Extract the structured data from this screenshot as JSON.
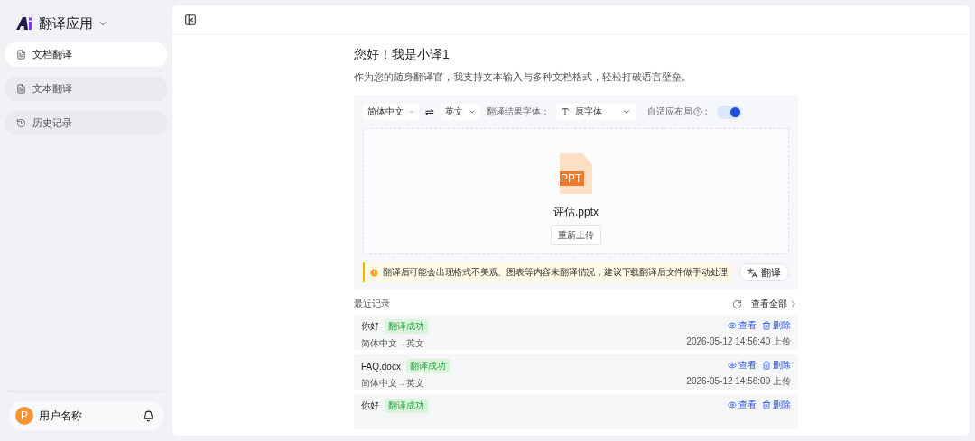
{
  "app": {
    "title": "翻译应用"
  },
  "sidebar": {
    "items": [
      {
        "label": "文档翻译",
        "selected": true
      },
      {
        "label": "文本翻译",
        "selected": false
      },
      {
        "label": "历史记录",
        "selected": false
      }
    ],
    "user": {
      "avatar": "P",
      "name": "用户名称"
    }
  },
  "greeting": {
    "title": "您好！我是小译1",
    "subtitle": "作为您的随身翻译官，我支持文本输入与多种文档格式，轻松打破语言壁垒。"
  },
  "toolbar": {
    "source_language": "简体中文",
    "swap": "⇌",
    "target_language": "英文",
    "font_label": "翻译结果字体：",
    "font": "原字体",
    "adaptive_label": "自适应布局",
    "adaptive_colon": "：",
    "adaptive_on": true
  },
  "upload": {
    "file_badge": "PPT",
    "file_name": "评估.pptx",
    "reupload": "重新上传"
  },
  "notice": "翻译后可能会出现格式不美观、图表等内容未翻译情况，建议下载翻译后文件做手动处理",
  "translate_button": "翻译",
  "recent": {
    "title": "最近记录",
    "view_all": "查看全部",
    "records": [
      {
        "name": "你好",
        "status": "翻译成功",
        "color": "#d9f5dc",
        "languages": "简体中文→英文",
        "time": "2026-05-12 14:56:40 上传",
        "view": "查看",
        "delete": "删除"
      },
      {
        "name": "FAQ.docx",
        "status": "翻译成功",
        "color": "#d9f5dc",
        "languages": "简体中文→英文",
        "time": "2026-05-12 14:56:09 上传",
        "view": "查看",
        "delete": "删除"
      },
      {
        "name": "你好",
        "status": "翻译成功",
        "color": "#d9f5dc",
        "view": "查看",
        "delete": "删除"
      }
    ]
  }
}
